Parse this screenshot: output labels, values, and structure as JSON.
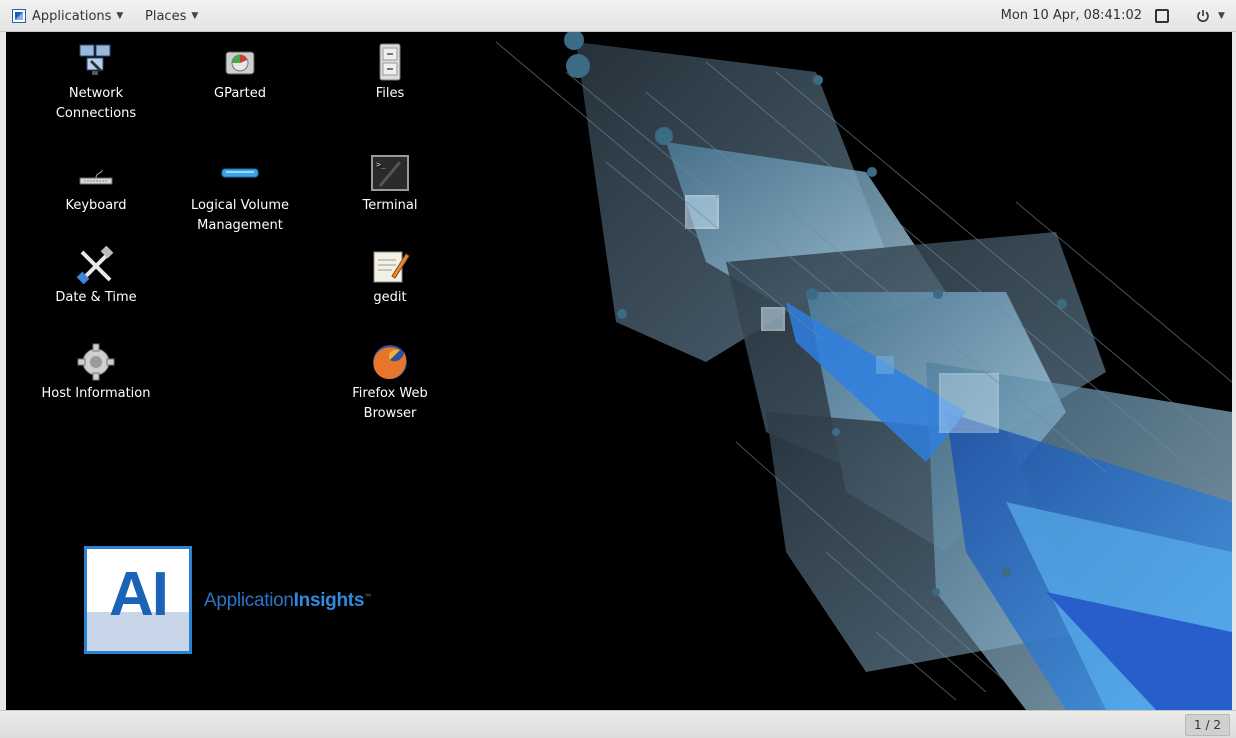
{
  "topbar": {
    "applications_label": "Applications",
    "places_label": "Places",
    "clock": "Mon 10 Apr, 08:41:02"
  },
  "desktop": {
    "icons": [
      {
        "label": "Network\nConnections",
        "icon": "network-connections-icon"
      },
      {
        "label": "GParted",
        "icon": "gparted-icon"
      },
      {
        "label": "Files",
        "icon": "files-icon"
      },
      {
        "label": "Keyboard",
        "icon": "keyboard-icon"
      },
      {
        "label": "Logical Volume\nManagement",
        "icon": "lvm-icon"
      },
      {
        "label": "Terminal",
        "icon": "terminal-icon"
      },
      {
        "label": "Date & Time",
        "icon": "date-time-icon"
      },
      {
        "label": "gedit",
        "icon": "gedit-icon"
      },
      {
        "label": "Host Information",
        "icon": "host-information-icon"
      },
      {
        "label": "Firefox Web\nBrowser",
        "icon": "firefox-icon"
      }
    ],
    "branding": {
      "logo_text": "AI",
      "wordmark_light": "Application",
      "wordmark_bold": "Insights",
      "trademark": "™"
    }
  },
  "bottombar": {
    "workspace_indicator": "1 / 2"
  },
  "colors": {
    "accent": "#2b82d0",
    "desktop_bg": "#000000"
  }
}
